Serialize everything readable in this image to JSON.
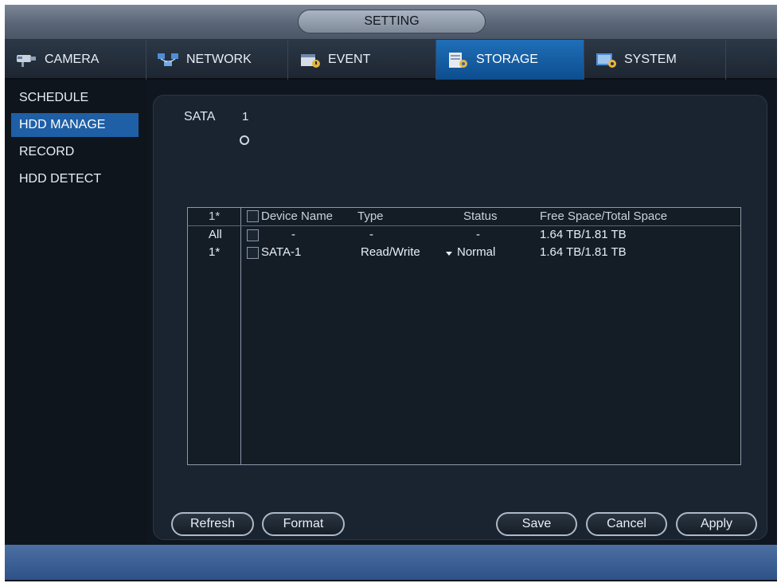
{
  "window": {
    "title": "SETTING"
  },
  "tabs": [
    {
      "label": "CAMERA",
      "icon": "camera-icon"
    },
    {
      "label": "NETWORK",
      "icon": "network-icon"
    },
    {
      "label": "EVENT",
      "icon": "event-icon"
    },
    {
      "label": "STORAGE",
      "icon": "storage-icon",
      "active": true
    },
    {
      "label": "SYSTEM",
      "icon": "system-icon"
    }
  ],
  "menu": [
    {
      "label": "SCHEDULE"
    },
    {
      "label": "HDD MANAGE",
      "active": true
    },
    {
      "label": "RECORD"
    },
    {
      "label": "HDD DETECT"
    }
  ],
  "sata": {
    "label": "SATA",
    "number": "1"
  },
  "table": {
    "headers": {
      "index": "1*",
      "device_name": "Device Name",
      "type": "Type",
      "status": "Status",
      "space": "Free Space/Total Space"
    },
    "rows": [
      {
        "index": "All",
        "device_name": "-",
        "type": "-",
        "status": "-",
        "space": "1.64 TB/1.81 TB"
      },
      {
        "index": "1*",
        "device_name": "SATA-1",
        "type": "Read/Write",
        "status": "Normal",
        "space": "1.64 TB/1.81 TB"
      }
    ]
  },
  "buttons": {
    "refresh": "Refresh",
    "format": "Format",
    "save": "Save",
    "cancel": "Cancel",
    "apply": "Apply"
  },
  "colors": {
    "active_tab": "#1f6fb8",
    "active_menu": "#1f5fa6",
    "status_bar": "#3d609a"
  }
}
